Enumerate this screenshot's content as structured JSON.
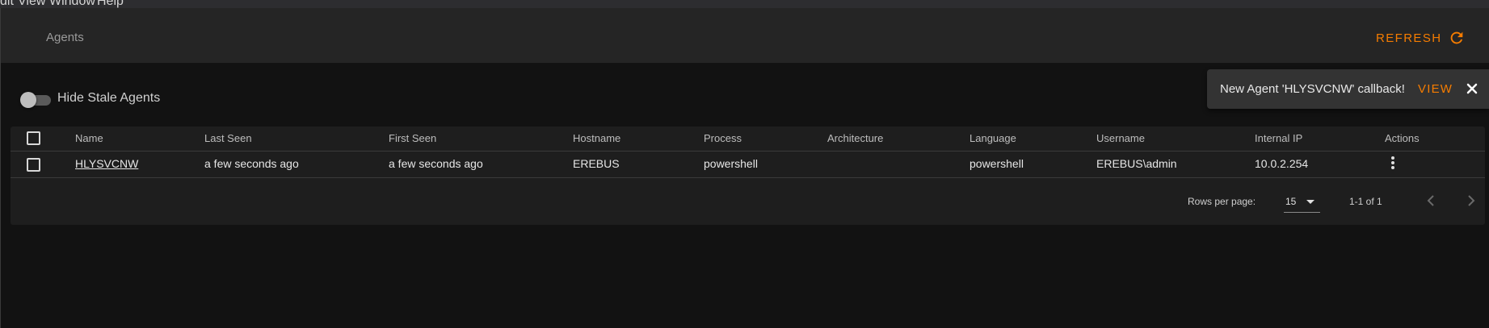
{
  "menubar": {
    "items": [
      "dit",
      "View",
      "Window",
      "Help"
    ]
  },
  "header": {
    "title": "Agents",
    "refresh_label": "REFRESH"
  },
  "filters": {
    "hide_stale_label": "Hide Stale Agents",
    "hide_stale_enabled": false
  },
  "snackbar": {
    "message": "New Agent 'HLYSVCNW' callback!",
    "action_label": "VIEW"
  },
  "table": {
    "columns": [
      "Name",
      "Last Seen",
      "First Seen",
      "Hostname",
      "Process",
      "Architecture",
      "Language",
      "Username",
      "Internal IP",
      "Actions"
    ],
    "rows": [
      {
        "name": "HLYSVCNW",
        "last_seen": "a few seconds ago",
        "first_seen": "a few seconds ago",
        "hostname": "EREBUS",
        "process": "powershell",
        "architecture": "",
        "language": "powershell",
        "username": "EREBUS\\admin",
        "internal_ip": "10.0.2.254"
      }
    ]
  },
  "pagination": {
    "rows_per_page_label": "Rows per page:",
    "rows_per_page": "15",
    "range": "1-1 of 1"
  },
  "colors": {
    "accent": "#f57c00",
    "background": "#121212",
    "appbar": "#252525",
    "card": "#1e1e1e"
  }
}
